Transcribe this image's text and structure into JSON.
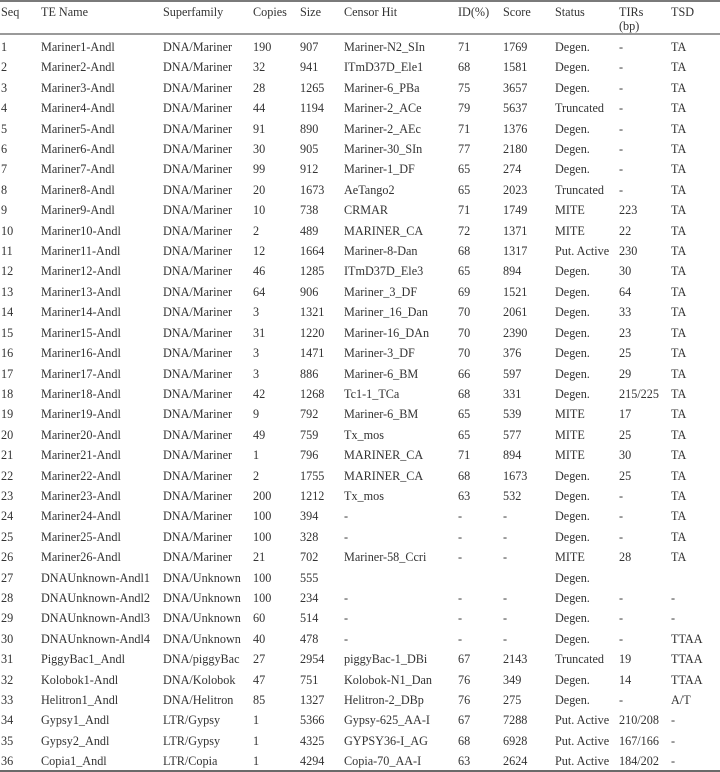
{
  "table": {
    "columns": [
      "Seq",
      "TE Name",
      "Superfamily",
      "Copies",
      "Size",
      "Censor Hit",
      "ID(%)",
      "Score",
      "Status",
      "TIRs (bp)",
      "TSD"
    ],
    "header_labels": {
      "seq": "Seq",
      "te_name": "TE Name",
      "superfamily": "Superfamily",
      "copies": "Copies",
      "size": "Size",
      "censor_hit": "Censor Hit",
      "id": "ID(%)",
      "score": "Score",
      "status": "Status",
      "tirs_line1": "TIRs",
      "tirs_line2": "(bp)",
      "tsd": "TSD"
    },
    "rows": [
      [
        "1",
        "Mariner1-Andl",
        "DNA/Mariner",
        "190",
        "907",
        "Mariner-N2_SIn",
        "71",
        "1769",
        "Degen.",
        "-",
        "TA"
      ],
      [
        "2",
        "Mariner2-Andl",
        "DNA/Mariner",
        "32",
        "941",
        "ITmD37D_Ele1",
        "68",
        "1581",
        "Degen.",
        "-",
        "TA"
      ],
      [
        "3",
        "Mariner3-Andl",
        "DNA/Mariner",
        "28",
        "1265",
        "Mariner-6_PBa",
        "75",
        "3657",
        "Degen.",
        "-",
        "TA"
      ],
      [
        "4",
        "Mariner4-Andl",
        "DNA/Mariner",
        "44",
        "1194",
        "Mariner-2_ACe",
        "79",
        "5637",
        "Truncated",
        "-",
        "TA"
      ],
      [
        "5",
        "Mariner5-Andl",
        "DNA/Mariner",
        "91",
        "890",
        "Mariner-2_AEc",
        "71",
        "1376",
        "Degen.",
        "-",
        "TA"
      ],
      [
        "6",
        "Mariner6-Andl",
        "DNA/Mariner",
        "30",
        "905",
        "Mariner-30_SIn",
        "77",
        "2180",
        "Degen.",
        "-",
        "TA"
      ],
      [
        "7",
        "Mariner7-Andl",
        "DNA/Mariner",
        "99",
        "912",
        "Mariner-1_DF",
        "65",
        "274",
        "Degen.",
        "-",
        "TA"
      ],
      [
        "8",
        "Mariner8-Andl",
        "DNA/Mariner",
        "20",
        "1673",
        "AeTango2",
        "65",
        "2023",
        "Truncated",
        "-",
        "TA"
      ],
      [
        "9",
        "Mariner9-Andl",
        "DNA/Mariner",
        "10",
        "738",
        "CRMAR",
        "71",
        "1749",
        "MITE",
        "223",
        "TA"
      ],
      [
        "10",
        "Mariner10-Andl",
        "DNA/Mariner",
        "2",
        "489",
        "MARINER_CA",
        "72",
        "1371",
        "MITE",
        "22",
        "TA"
      ],
      [
        "11",
        "Mariner11-Andl",
        "DNA/Mariner",
        "12",
        "1664",
        "Mariner-8-Dan",
        "68",
        "1317",
        "Put. Active",
        "230",
        "TA"
      ],
      [
        "12",
        "Mariner12-Andl",
        "DNA/Mariner",
        "46",
        "1285",
        "ITmD37D_Ele3",
        "65",
        "894",
        "Degen.",
        "30",
        "TA"
      ],
      [
        "13",
        "Mariner13-Andl",
        "DNA/Mariner",
        "64",
        "906",
        "Mariner_3_DF",
        "69",
        "1521",
        "Degen.",
        "64",
        "TA"
      ],
      [
        "14",
        "Mariner14-Andl",
        "DNA/Mariner",
        "3",
        "1321",
        "Mariner_16_Dan",
        "70",
        "2061",
        "Degen.",
        "33",
        "TA"
      ],
      [
        "15",
        "Mariner15-Andl",
        "DNA/Mariner",
        "31",
        "1220",
        "Mariner-16_DAn",
        "70",
        "2390",
        "Degen.",
        "23",
        "TA"
      ],
      [
        "16",
        "Mariner16-Andl",
        "DNA/Mariner",
        "3",
        "1471",
        "Mariner-3_DF",
        "70",
        "376",
        "Degen.",
        "25",
        "TA"
      ],
      [
        "17",
        "Mariner17-Andl",
        "DNA/Mariner",
        "3",
        "886",
        "Mariner-6_BM",
        "66",
        "597",
        "Degen.",
        "29",
        "TA"
      ],
      [
        "18",
        "Mariner18-Andl",
        "DNA/Mariner",
        "42",
        "1268",
        "Tc1-1_TCa",
        "68",
        "331",
        "Degen.",
        "215/225",
        "TA"
      ],
      [
        "19",
        "Mariner19-Andl",
        "DNA/Mariner",
        "9",
        "792",
        "Mariner-6_BM",
        "65",
        "539",
        "MITE",
        "17",
        "TA"
      ],
      [
        "20",
        "Mariner20-Andl",
        "DNA/Mariner",
        "49",
        "759",
        "Tx_mos",
        "65",
        "577",
        "MITE",
        "25",
        "TA"
      ],
      [
        "21",
        "Mariner21-Andl",
        "DNA/Mariner",
        "1",
        "796",
        "MARINER_CA",
        "71",
        "894",
        "MITE",
        "30",
        "TA"
      ],
      [
        "22",
        "Mariner22-Andl",
        "DNA/Mariner",
        "2",
        "1755",
        "MARINER_CA",
        "68",
        "1673",
        "Degen.",
        "25",
        "TA"
      ],
      [
        "23",
        "Mariner23-Andl",
        "DNA/Mariner",
        "200",
        "1212",
        "Tx_mos",
        "63",
        "532",
        "Degen.",
        "-",
        "TA"
      ],
      [
        "24",
        "Mariner24-Andl",
        "DNA/Mariner",
        "100",
        "394",
        "-",
        "-",
        "-",
        "Degen.",
        "-",
        "TA"
      ],
      [
        "25",
        "Mariner25-Andl",
        "DNA/Mariner",
        "100",
        "328",
        "-",
        "-",
        "-",
        "Degen.",
        "-",
        "TA"
      ],
      [
        "26",
        "Mariner26-Andl",
        "DNA/Mariner",
        "21",
        "702",
        "Mariner-58_Ccri",
        "-",
        "-",
        "MITE",
        "28",
        "TA"
      ],
      [
        "27",
        "DNAUnknown-Andl1",
        "DNA/Unknown",
        "100",
        "555",
        "",
        "",
        "",
        "Degen.",
        "",
        ""
      ],
      [
        "28",
        "DNAUnknown-Andl2",
        "DNA/Unknown",
        "100",
        "234",
        "-",
        "-",
        "-",
        "Degen.",
        "-",
        "-"
      ],
      [
        "29",
        "DNAUnknown-Andl3",
        "DNA/Unknown",
        "60",
        "514",
        "-",
        "-",
        "-",
        "Degen.",
        "-",
        "-"
      ],
      [
        "30",
        "DNAUnknown-Andl4",
        "DNA/Unknown",
        "40",
        "478",
        "-",
        "-",
        "-",
        "Degen.",
        "-",
        "TTAA"
      ],
      [
        "31",
        "PiggyBac1_Andl",
        "DNA/piggyBac",
        "27",
        "2954",
        "piggyBac-1_DBi",
        "67",
        "2143",
        "Truncated",
        "19",
        "TTAA"
      ],
      [
        "32",
        "Kolobok1-Andl",
        "DNA/Kolobok",
        "47",
        "751",
        "Kolobok-N1_Dan",
        "76",
        "349",
        "Degen.",
        "14",
        "TTAA"
      ],
      [
        "33",
        "Helitron1_Andl",
        "DNA/Helitron",
        "85",
        "1327",
        "Helitron-2_DBp",
        "76",
        "275",
        "Degen.",
        "-",
        "A/T"
      ],
      [
        "34",
        "Gypsy1_Andl",
        "LTR/Gypsy",
        "1",
        "5366",
        "Gypsy-625_AA-I",
        "67",
        "7288",
        "Put. Active",
        "210/208",
        "-"
      ],
      [
        "35",
        "Gypsy2_Andl",
        "LTR/Gypsy",
        "1",
        "4325",
        "GYPSY36-I_AG",
        "68",
        "6928",
        "Put. Active",
        "167/166",
        "-"
      ],
      [
        "36",
        "Copia1_Andl",
        "LTR/Copia",
        "1",
        "4294",
        "Copia-70_AA-I",
        "63",
        "2624",
        "Put. Active",
        "184/202",
        "-"
      ]
    ]
  }
}
